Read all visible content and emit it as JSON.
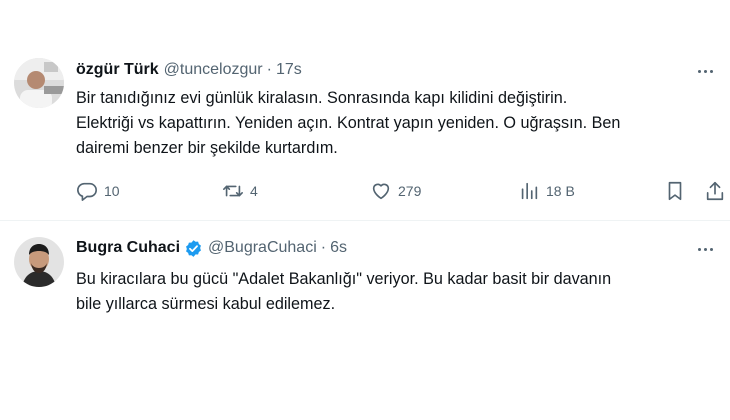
{
  "tweets": [
    {
      "name": "özgür Türk",
      "handle": "@tuncelozgur",
      "separator": "·",
      "time": "17s",
      "text": "Bir tanıdığınız evi günlük kiralasın. Sonrasında kapı kilidini değiştirin.\nElektriği vs kapattırın. Yeniden açın. Kontrat yapın yeniden. O uğraşsın. Ben\ndairemi benzer bir şekilde kurtardım.",
      "replies": "10",
      "retweets": "4",
      "likes": "279",
      "views": "18 B",
      "verified": false
    },
    {
      "name": "Bugra Cuhaci",
      "handle": "@BugraCuhaci",
      "separator": "·",
      "time": "6s",
      "text": "Bu kiracılara bu gücü \"Adalet Bakanlığı\" veriyor. Bu kadar basit bir davanın\nbile yıllarca sürmesi kabul edilemez.",
      "verified": true
    }
  ],
  "icons": {
    "reply": "reply-icon",
    "retweet": "retweet-icon",
    "like": "heart-icon",
    "views": "views-icon",
    "bookmark": "bookmark-icon",
    "share": "share-icon",
    "more": "more-icon",
    "verified": "verified-badge-icon"
  },
  "colors": {
    "verified": "#1d9bf0",
    "secondary_text": "#536471",
    "divider": "#eff3f4"
  }
}
